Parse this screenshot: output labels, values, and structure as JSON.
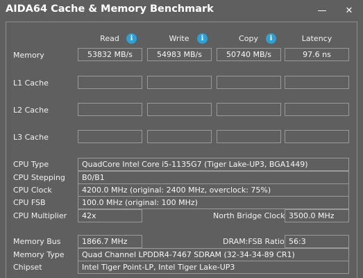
{
  "window": {
    "title": "AIDA64 Cache & Memory Benchmark",
    "minimize_glyph": "—",
    "close_glyph": "✕"
  },
  "columns": {
    "read": "Read",
    "write": "Write",
    "copy": "Copy",
    "latency": "Latency",
    "info_glyph": "i"
  },
  "rows": {
    "memory": {
      "label": "Memory",
      "read": "53832 MB/s",
      "write": "54983 MB/s",
      "copy": "50740 MB/s",
      "latency": "97.6 ns"
    },
    "l1": {
      "label": "L1 Cache",
      "read": "",
      "write": "",
      "copy": "",
      "latency": ""
    },
    "l2": {
      "label": "L2 Cache",
      "read": "",
      "write": "",
      "copy": "",
      "latency": ""
    },
    "l3": {
      "label": "L3 Cache",
      "read": "",
      "write": "",
      "copy": "",
      "latency": ""
    }
  },
  "cpu": {
    "type_label": "CPU Type",
    "type_value": "QuadCore Intel Core i5-1135G7  (Tiger Lake-UP3, BGA1449)",
    "stepping_label": "CPU Stepping",
    "stepping_value": "B0/B1",
    "clock_label": "CPU Clock",
    "clock_value": "4200.0 MHz  (original: 2400 MHz, overclock: 75%)",
    "fsb_label": "CPU FSB",
    "fsb_value": "100.0 MHz  (original: 100 MHz)",
    "multiplier_label": "CPU Multiplier",
    "multiplier_value": "42x",
    "nb_clock_label": "North Bridge Clock",
    "nb_clock_value": "3500.0 MHz"
  },
  "memory_info": {
    "bus_label": "Memory Bus",
    "bus_value": "1866.7 MHz",
    "ratio_label": "DRAM:FSB Ratio",
    "ratio_value": "56:3",
    "type_label": "Memory Type",
    "type_value": "Quad Channel LPDDR4-7467 SDRAM  (32-34-34-89 CR1)",
    "chipset_label": "Chipset",
    "chipset_value": "Intel Tiger Point-LP, Intel Tiger Lake-UP3"
  },
  "colors": {
    "background": "#5f5f60",
    "info_icon": "#2f9fd4",
    "border": "#9a9a9a"
  }
}
